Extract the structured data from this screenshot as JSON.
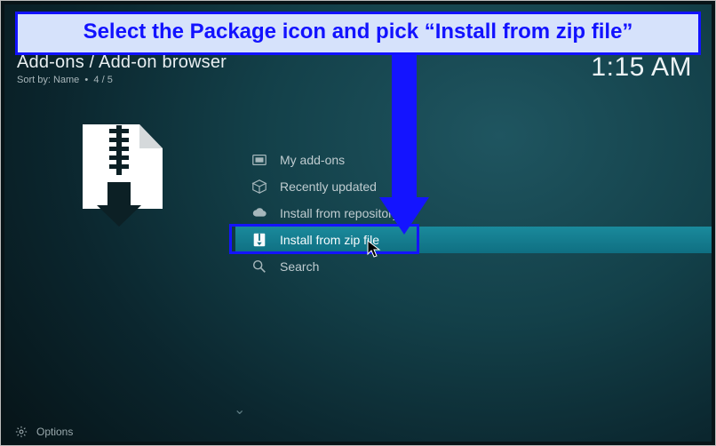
{
  "banner": {
    "text": "Select the Package icon and pick “Install from zip file”"
  },
  "header": {
    "title": "Add-ons / Add-on browser",
    "sort_label": "Sort by: Name",
    "position": "4 / 5"
  },
  "clock": "1:15 AM",
  "menu": {
    "items": [
      {
        "icon": "addons-icon",
        "label": "My add-ons"
      },
      {
        "icon": "box-icon",
        "label": "Recently updated"
      },
      {
        "icon": "cloud-icon",
        "label": "Install from repository"
      },
      {
        "icon": "zip-icon",
        "label": "Install from zip file"
      },
      {
        "icon": "search-icon",
        "label": "Search"
      }
    ],
    "selected_index": 3
  },
  "footer": {
    "options_label": "Options"
  }
}
